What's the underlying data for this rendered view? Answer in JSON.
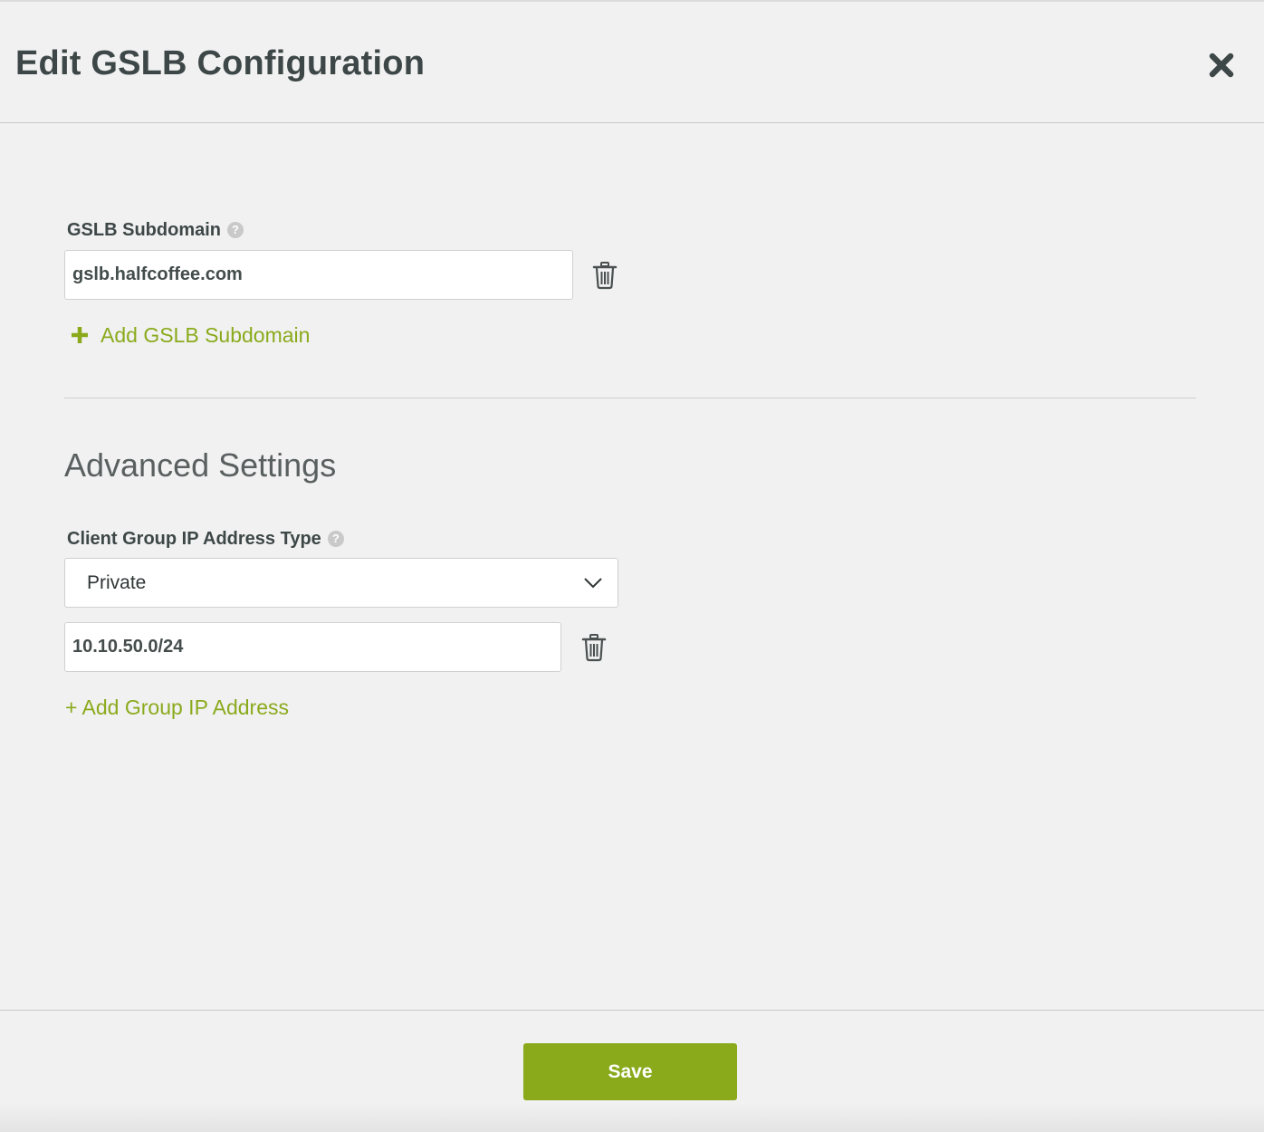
{
  "dialog": {
    "title": "Edit GSLB Configuration",
    "close_icon": "close-icon"
  },
  "gslb": {
    "label": "GSLB Subdomain",
    "help_icon": "question-circle-icon",
    "subdomains": [
      "gslb.halfcoffee.com"
    ],
    "delete_icon": "trash-icon",
    "add_icon": "plus-icon",
    "add_label": "Add GSLB Subdomain"
  },
  "advanced": {
    "title": "Advanced Settings",
    "ip_type": {
      "label": "Client Group IP Address Type",
      "help_icon": "question-circle-icon",
      "selected": "Private",
      "chevron_icon": "chevron-down-icon"
    },
    "group_ips": [
      "10.10.50.0/24"
    ],
    "delete_icon": "trash-icon",
    "add_label": "+ Add Group IP Address"
  },
  "footer": {
    "save_label": "Save"
  },
  "colors": {
    "accent": "#8aaa1c",
    "background": "#f1f1f1",
    "text": "#3e4747",
    "border": "#d0d0d0"
  }
}
